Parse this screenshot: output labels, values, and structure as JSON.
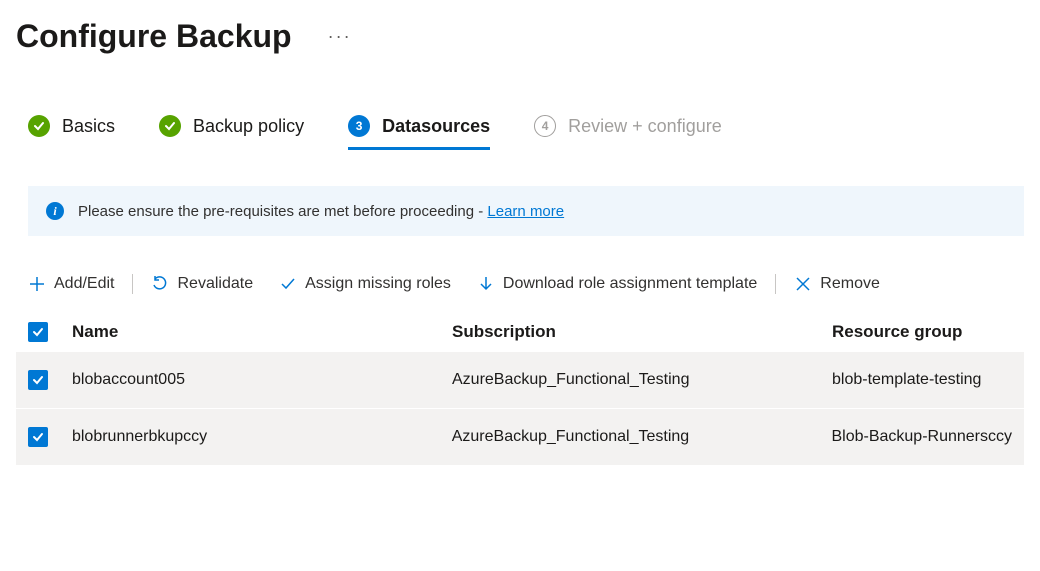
{
  "page_title": "Configure Backup",
  "steps": {
    "basics": "Basics",
    "backup_policy": "Backup policy",
    "datasources_num": "3",
    "datasources": "Datasources",
    "review_num": "4",
    "review": "Review + configure"
  },
  "info": {
    "text": "Please ensure the pre-requisites are met before proceeding - ",
    "link": "Learn more"
  },
  "toolbar": {
    "add_edit": "Add/Edit",
    "revalidate": "Revalidate",
    "assign_roles": "Assign missing roles",
    "download": "Download role assignment template",
    "remove": "Remove"
  },
  "table": {
    "headers": {
      "name": "Name",
      "subscription": "Subscription",
      "resource_group": "Resource group"
    },
    "rows": [
      {
        "name": "blobaccount005",
        "subscription": "AzureBackup_Functional_Testing",
        "rg": "blob-template-testing"
      },
      {
        "name": "blobrunnerbkupccy",
        "subscription": "AzureBackup_Functional_Testing",
        "rg": "Blob-Backup-Runnersccy"
      }
    ]
  }
}
